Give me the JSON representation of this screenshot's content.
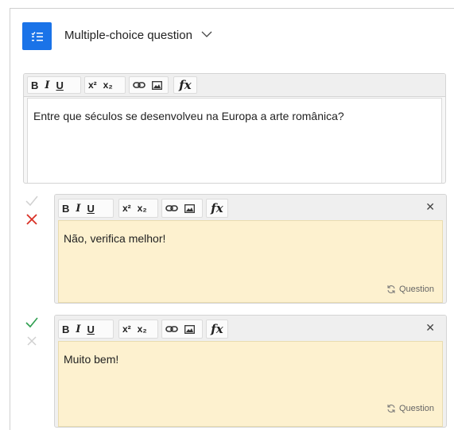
{
  "header": {
    "question_type_label": "Multiple-choice question"
  },
  "toolbar": {
    "bold": "B",
    "italic": "I",
    "underline": "U",
    "superscript": "x²",
    "subscript": "x₂",
    "formula": "fx"
  },
  "question": {
    "text": "Entre que séculos se desenvolveu na Europa a arte românica?"
  },
  "answers": [
    {
      "correct": false,
      "feedback": "Não, verifica melhor!",
      "link_label": "Question"
    },
    {
      "correct": true,
      "feedback": "Muito bem!",
      "link_label": "Question"
    }
  ],
  "colors": {
    "accent": "#1a73e8",
    "correct": "#2e9e4f",
    "incorrect": "#d93025",
    "feedback_bg": "#fdf1cf"
  }
}
